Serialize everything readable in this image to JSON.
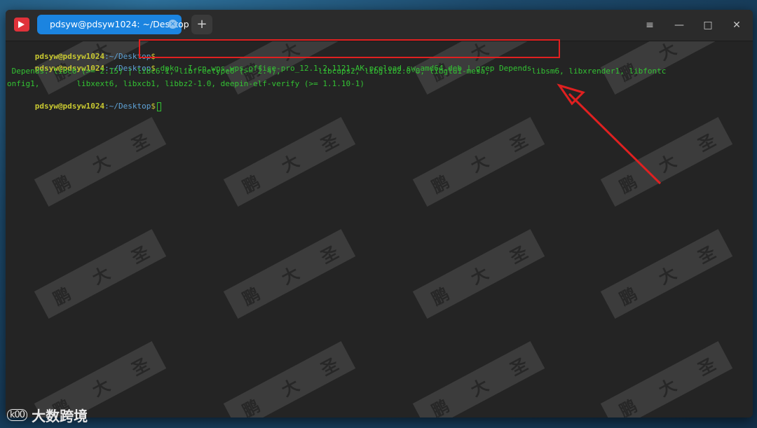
{
  "window": {
    "tab_title": "pdsyw@pdsyw1024: ~/Desktop",
    "tab_close": "×",
    "add_tab": "+",
    "menu_icon": "≡",
    "minimize_icon": "—",
    "maximize_icon": "□",
    "close_icon": "✕"
  },
  "terminal": {
    "lines": [
      {
        "user": "pdsyw@pdsyw1024",
        "path": ":~/Desktop",
        "dollar": "$",
        "cmd": ""
      },
      {
        "user": "pdsyw@pdsyw1024",
        "path": ":~/Desktop",
        "dollar": "$",
        "cmd": " dpkg -I cn.wps.wps-office-pro_12.1.2.1121.AK.preload.sw_amd64.deb | grep Depends"
      },
      {
        "out": " Depends: libc6 (>= 2.15) | libc6.1, libfreetype6 (>= 2.4),        libcups2, libglib2.0-0, libglu1-mesa,         libsm6, libxrender1, libfontc"
      },
      {
        "out": "onfig1,        libxext6, libxcb1, libbz2-1.0, deepin-elf-verify (>= 1.1.10-1)"
      },
      {
        "user": "pdsyw@pdsyw1024",
        "path": ":~/Desktop",
        "dollar": "$",
        "cmd": " "
      }
    ]
  },
  "watermark": {
    "chars": [
      "鹏",
      "大",
      "圣"
    ]
  },
  "brand": {
    "logo": "k00",
    "name": "大数跨境"
  },
  "colors": {
    "tab_active": "#1b84e0",
    "highlight": "#e02020",
    "prompt": "#c9c931",
    "path": "#5fa3d8",
    "output": "#33c233"
  }
}
